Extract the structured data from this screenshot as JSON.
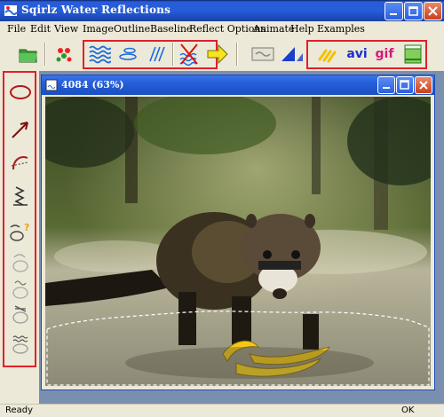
{
  "window": {
    "title": "Sqirlz Water Reflections"
  },
  "menu": [
    {
      "label": "File"
    },
    {
      "label": "Edit"
    },
    {
      "label": "View"
    },
    {
      "label": "Image"
    },
    {
      "label": "Outline"
    },
    {
      "label": "Baseline"
    },
    {
      "label": "Reflect Options"
    },
    {
      "label": "Animate"
    },
    {
      "label": "Help"
    },
    {
      "label": "Examples"
    }
  ],
  "toolbar": {
    "avi_label": "avi",
    "gif_label": "gif"
  },
  "document": {
    "title": "4084   (63%)"
  },
  "status": {
    "left": "Ready",
    "right": "OK"
  },
  "colors": {
    "highlight_box": "#e0202a",
    "titlebar": "#245edb",
    "mdi_background": "#7a8fb0"
  }
}
